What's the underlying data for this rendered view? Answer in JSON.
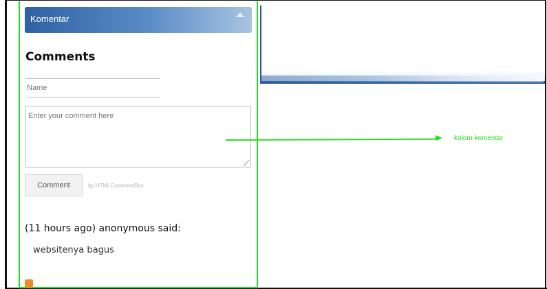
{
  "widget": {
    "header_title": "Komentar",
    "section_title": "Comments"
  },
  "form": {
    "name_placeholder": "Name",
    "comment_placeholder": "Enter your comment here",
    "submit_label": "Comment",
    "powered_by": "by HTMLCommentBox"
  },
  "comment": {
    "meta": "(11 hours ago) anonymous said:",
    "text": "websitenya bagus"
  },
  "annotation": {
    "label": "kolom komentar",
    "color": "#22dd22"
  }
}
